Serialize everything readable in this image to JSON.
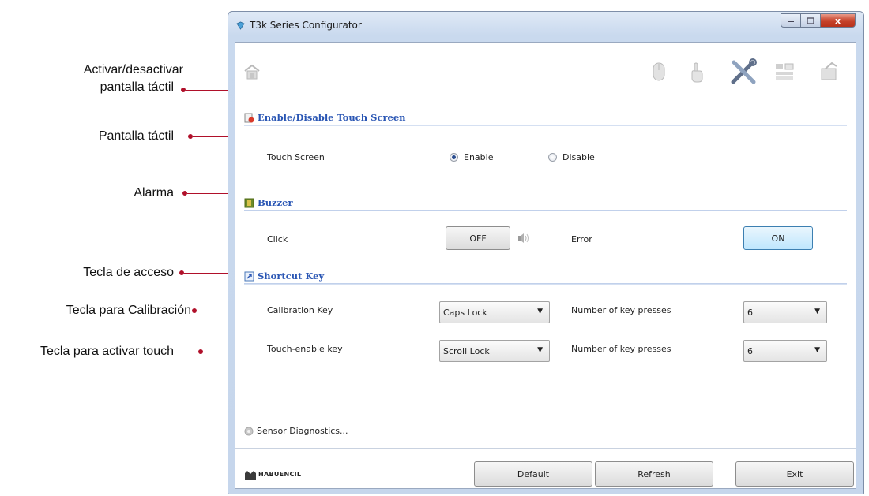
{
  "callouts": {
    "activate_line1": "Activar/desactivar",
    "activate_line2": "pantalla táctil",
    "touchscreen": "Pantalla táctil",
    "alarm": "Alarma",
    "shortcut": "Tecla de acceso",
    "calibration": "Tecla para Calibración",
    "touch_key": "Tecla para activar touch"
  },
  "window": {
    "title": "T3k Series Configurator",
    "min_icon": "minimize-icon",
    "max_icon": "maximize-icon",
    "close_glyph": "x"
  },
  "toolbar": {
    "icons": [
      "home-icon",
      "mouse-icon",
      "touch-hand-icon",
      "tools-icon",
      "layout-icon",
      "settings-icon"
    ]
  },
  "sections": {
    "touch": {
      "title": "Enable/Disable Touch Screen",
      "row_label": "Touch Screen",
      "option_enable": "Enable",
      "option_disable": "Disable",
      "selected": "Enable"
    },
    "buzzer": {
      "title": "Buzzer",
      "click_label": "Click",
      "click_button": "OFF",
      "error_label": "Error",
      "error_button": "ON"
    },
    "shortcut": {
      "title": "Shortcut Key",
      "calibration_label": "Calibration Key",
      "calibration_value": "Caps Lock",
      "calibration_presses_label": "Number of key presses",
      "calibration_presses": "6",
      "touch_label": "Touch-enable key",
      "touch_value": "Scroll Lock",
      "touch_presses_label": "Number of key presses",
      "touch_presses": "6"
    }
  },
  "diagnostics_label": "Sensor Diagnostics...",
  "footer": {
    "logo_text": "HABUENCIL",
    "default_button": "Default",
    "refresh_button": "Refresh",
    "exit_button": "Exit"
  },
  "colors": {
    "accent": "#2a56b4",
    "callout_red": "#b0102a",
    "on_button": "#bee6fd"
  }
}
